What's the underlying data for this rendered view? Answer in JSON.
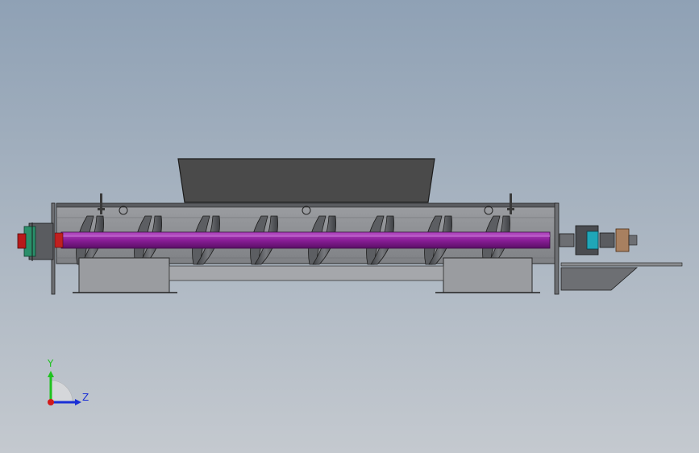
{
  "triad": {
    "y_label": "Y",
    "z_label": "Z",
    "y_color": "#1fc21f",
    "z_color": "#1a2fd6",
    "x_color": "#d21a1a"
  },
  "model": {
    "hopper_color": "#4a4a4a",
    "trough_color": "#8a8c90",
    "shaft_color": "#8a1e98",
    "flight_color": "#5c5e62",
    "support_color": "#9a9ca0",
    "motor_accent_color": "#2a8f6a",
    "coupling_color": "#1fa6b8"
  }
}
